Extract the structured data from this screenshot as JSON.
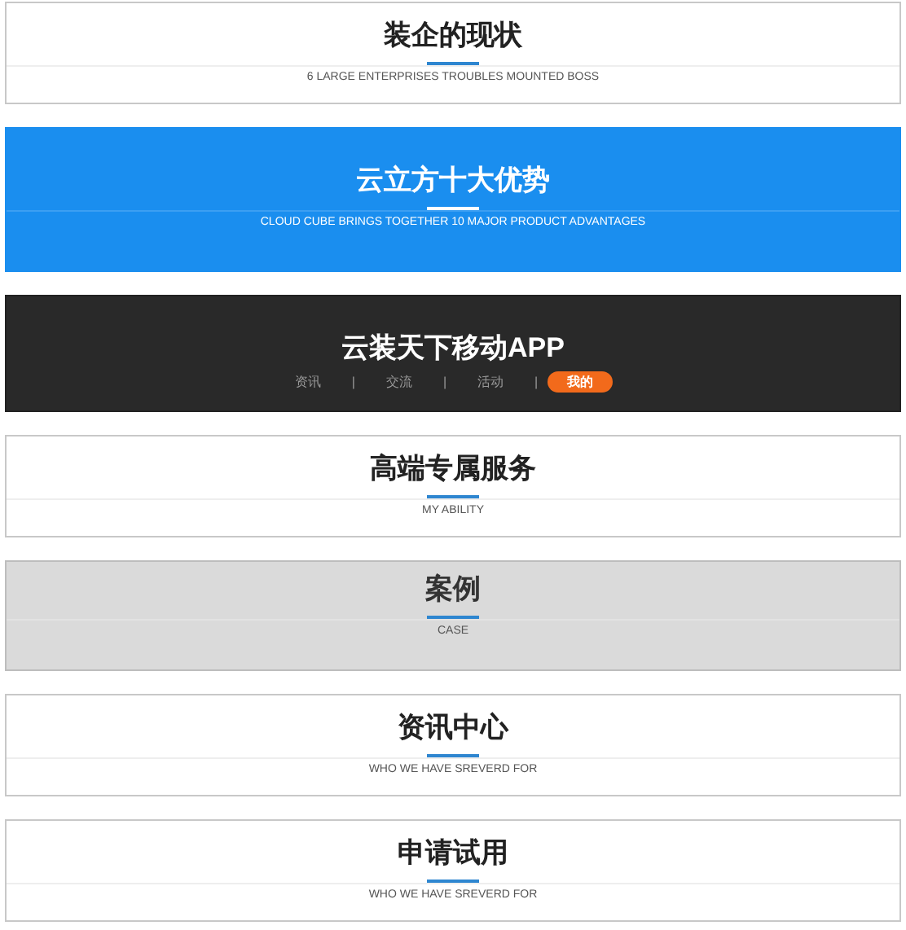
{
  "sections": [
    {
      "kind": "light",
      "title": "装企的现状",
      "subtitle": "6 LARGE ENTERPRISES TROUBLES MOUNTED BOSS"
    },
    {
      "kind": "blue",
      "title": "云立方十大优势",
      "subtitle": "CLOUD CUBE BRINGS TOGETHER 10 MAJOR PRODUCT ADVANTAGES"
    },
    {
      "kind": "dark",
      "title": "云装天下移动APP",
      "nav": [
        {
          "kind": "tab",
          "label": "资讯",
          "selected": false
        },
        {
          "kind": "separator",
          "text": "|"
        },
        {
          "kind": "tab",
          "label": "交流",
          "selected": false
        },
        {
          "kind": "separator",
          "text": "|"
        },
        {
          "kind": "tab",
          "label": "活动",
          "selected": false
        },
        {
          "kind": "separator",
          "text": "|"
        },
        {
          "kind": "tab",
          "label": "我的",
          "selected": true
        }
      ]
    },
    {
      "kind": "light",
      "title": "高端专属服务",
      "subtitle": "MY ABILITY"
    },
    {
      "kind": "gray",
      "title": "案例",
      "subtitle": "CASE"
    },
    {
      "kind": "light",
      "title": "资讯中心",
      "subtitle": "WHO WE HAVE SREVERD FOR"
    },
    {
      "kind": "light",
      "title": "申请试用",
      "subtitle": "WHO WE HAVE SREVERD FOR"
    }
  ]
}
